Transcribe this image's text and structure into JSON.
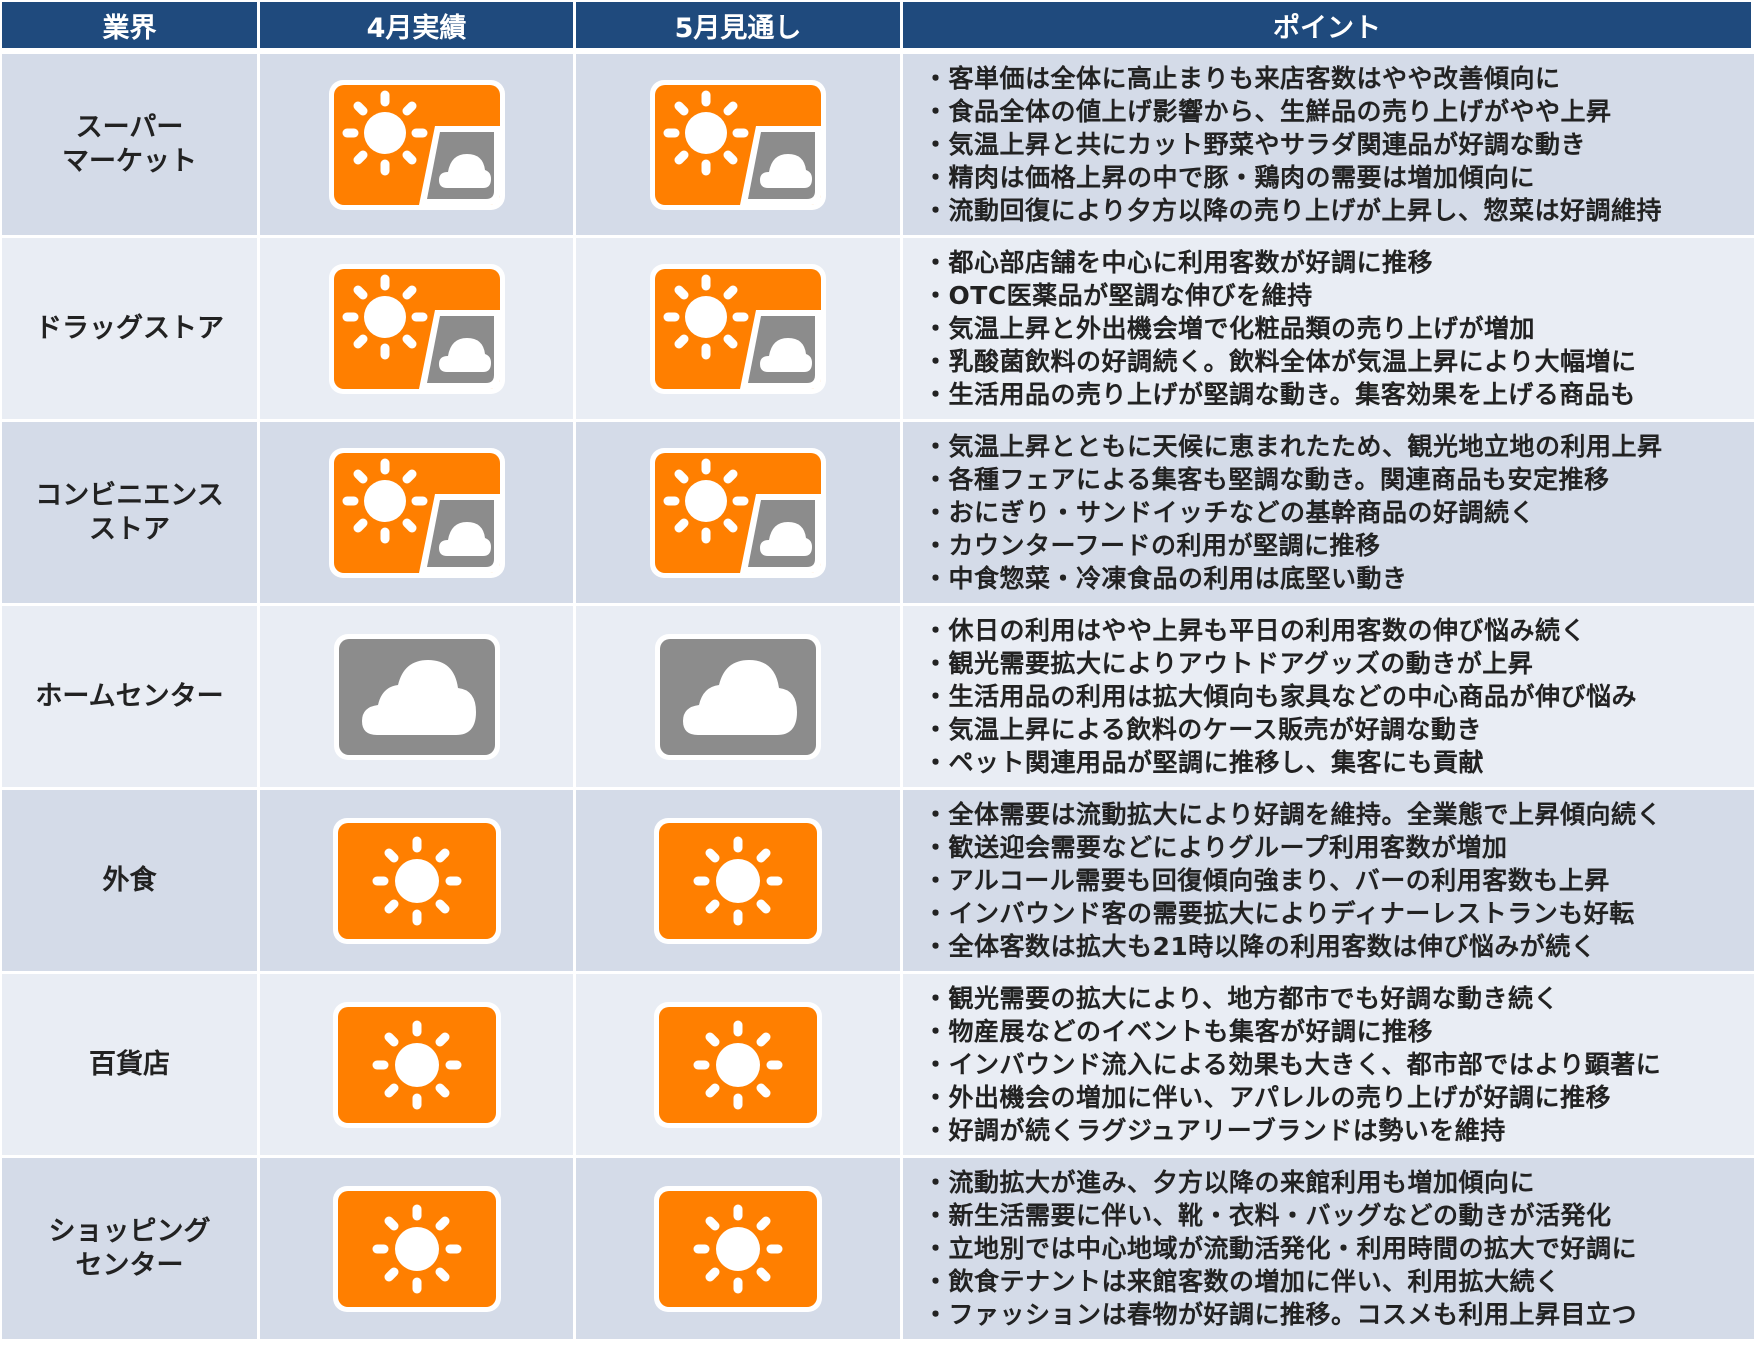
{
  "colors": {
    "header_bg": "#1f4a7d",
    "row_even": "#d4dbe8",
    "row_odd": "#e9edf4",
    "sun_orange": "#ff7f00",
    "cloud_gray": "#8c8c8c"
  },
  "header": {
    "industry": "業界",
    "april": "4月実績",
    "may": "5月見通し",
    "points": "ポイント"
  },
  "rows": [
    {
      "industry": "スーパー\nマーケット",
      "april": "sunny-partly-cloudy-icon",
      "may": "sunny-partly-cloudy-icon",
      "points": [
        "客単価は全体に高止まりも来店客数はやや改善傾向に",
        "食品全体の値上げ影響から、生鮮品の売り上げがやや上昇",
        "気温上昇と共にカット野菜やサラダ関連品が好調な動き",
        "精肉は価格上昇の中で豚・鶏肉の需要は増加傾向に",
        "流動回復により夕方以降の売り上げが上昇し、惣菜は好調維持"
      ]
    },
    {
      "industry": "ドラッグストア",
      "april": "sunny-partly-cloudy-icon",
      "may": "sunny-partly-cloudy-icon",
      "points": [
        "都心部店舗を中心に利用客数が好調に推移",
        "OTC医薬品が堅調な伸びを維持",
        "気温上昇と外出機会増で化粧品類の売り上げが増加",
        "乳酸菌飲料の好調続く。飲料全体が気温上昇により大幅増に",
        "生活用品の売り上げが堅調な動き。集客効果を上げる商品も"
      ]
    },
    {
      "industry": "コンビニエンス\nストア",
      "april": "sunny-partly-cloudy-icon",
      "may": "sunny-partly-cloudy-icon",
      "points": [
        "気温上昇とともに天候に恵まれたため、観光地立地の利用上昇",
        "各種フェアによる集客も堅調な動き。関連商品も安定推移",
        "おにぎり・サンドイッチなどの基幹商品の好調続く",
        "カウンターフードの利用が堅調に推移",
        "中食惣菜・冷凍食品の利用は底堅い動き"
      ]
    },
    {
      "industry": "ホームセンター",
      "april": "cloudy-icon",
      "may": "cloudy-icon",
      "points": [
        "休日の利用はやや上昇も平日の利用客数の伸び悩み続く",
        "観光需要拡大によりアウトドアグッズの動きが上昇",
        "生活用品の利用は拡大傾向も家具などの中心商品が伸び悩み",
        "気温上昇による飲料のケース販売が好調な動き",
        "ペット関連用品が堅調に推移し、集客にも貢献"
      ]
    },
    {
      "industry": "外食",
      "april": "sunny-icon",
      "may": "sunny-icon",
      "points": [
        "全体需要は流動拡大により好調を維持。全業態で上昇傾向続く",
        "歓送迎会需要などによりグループ利用客数が増加",
        "アルコール需要も回復傾向強まり、バーの利用客数も上昇",
        "インバウンド客の需要拡大によりディナーレストランも好転",
        "全体客数は拡大も21時以降の利用客数は伸び悩みが続く"
      ]
    },
    {
      "industry": "百貨店",
      "april": "sunny-icon",
      "may": "sunny-icon",
      "points": [
        "観光需要の拡大により、地方都市でも好調な動き続く",
        "物産展などのイベントも集客が好調に推移",
        "インバウンド流入による効果も大きく、都市部ではより顕著に",
        "外出機会の増加に伴い、アパレルの売り上げが好調に推移",
        "好調が続くラグジュアリーブランドは勢いを維持"
      ]
    },
    {
      "industry": "ショッピング\nセンター",
      "april": "sunny-icon",
      "may": "sunny-icon",
      "points": [
        "流動拡大が進み、夕方以降の来館利用も増加傾向に",
        "新生活需要に伴い、靴・衣料・バッグなどの動きが活発化",
        "立地別では中心地域が流動活発化・利用時間の拡大で好調に",
        "飲食テナントは来館客数の増加に伴い、利用拡大続く",
        "ファッションは春物が好調に推移。コスメも利用上昇目立つ"
      ]
    }
  ]
}
